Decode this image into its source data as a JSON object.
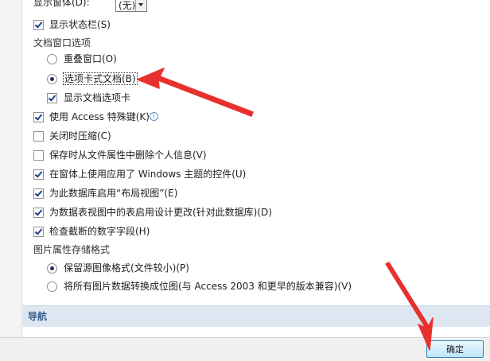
{
  "colors": {
    "annotation_red": "#e8302f",
    "nav_bar": "#dde6f1",
    "accent": "#3a5f8f"
  },
  "options": {
    "display_form_label": "显示窗体(D):",
    "display_form_value": "(无)",
    "show_status_bar": {
      "label": "显示状态栏(S)",
      "checked": true
    },
    "doc_window_header": "文档窗口选项",
    "overlapping_windows": {
      "label": "重叠窗口(O)",
      "selected": false
    },
    "tabbed_documents": {
      "label": "选项卡式文档(B)",
      "selected": true
    },
    "show_document_tabs": {
      "label": "显示文档选项卡",
      "checked": true
    },
    "access_special_keys": {
      "label": "使用 Access 特殊键(K)",
      "checked": true,
      "icon": "info-icon"
    },
    "compact_on_close": {
      "label": "关闭时压缩(C)",
      "checked": false
    },
    "remove_personal_info": {
      "label": "保存时从文件属性中删除个人信息(V)",
      "checked": false
    },
    "windows_themed_controls": {
      "label": "在窗体上使用应用了 Windows 主题的控件(U)",
      "checked": true
    },
    "enable_layout_view": {
      "label": "为此数据库启用“布局视图”(E)",
      "checked": true
    },
    "design_changes_datasheet": {
      "label": "为数据表视图中的表启用设计更改(针对此数据库)(D)",
      "checked": true
    },
    "check_truncated_fields": {
      "label": "检查截断的数字字段(H)",
      "checked": true
    },
    "picture_storage_header": "图片属性存储格式",
    "preserve_source_format": {
      "label": "保留源图像格式(文件较小)(P)",
      "selected": true
    },
    "convert_to_bitmaps": {
      "label": "将所有图片数据转换成位图(与 Access 2003 和更早的版本兼容)(V)",
      "selected": false
    }
  },
  "navigation": {
    "title": "导航"
  },
  "footer": {
    "ok_label": "确定"
  }
}
